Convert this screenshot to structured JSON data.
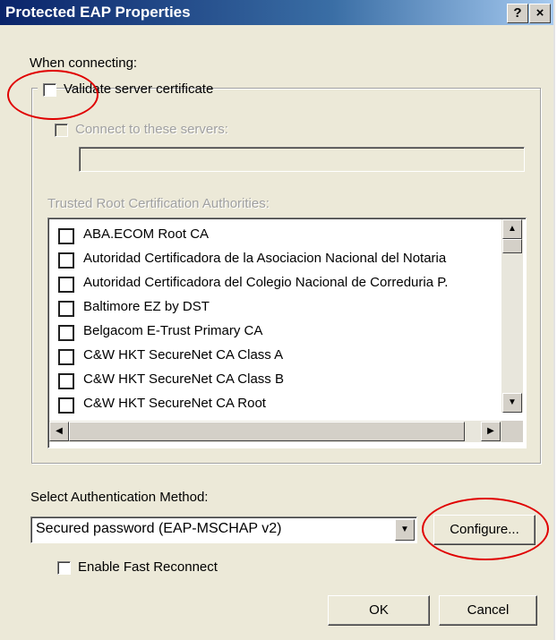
{
  "window": {
    "title": "Protected EAP Properties",
    "help_button": "?",
    "close_button": "×"
  },
  "connecting": {
    "heading": "When connecting:",
    "validate_label": "Validate server certificate",
    "validate_checked": false,
    "connect_label": "Connect to these servers:",
    "connect_checked": false,
    "servers_value": ""
  },
  "trusted": {
    "label": "Trusted Root Certification Authorities:",
    "items": [
      {
        "label": "ABA.ECOM Root CA",
        "checked": false
      },
      {
        "label": "Autoridad Certificadora de la Asociacion Nacional del Notaria",
        "checked": false
      },
      {
        "label": "Autoridad Certificadora del Colegio Nacional de Correduria P.",
        "checked": false
      },
      {
        "label": "Baltimore EZ by DST",
        "checked": false
      },
      {
        "label": "Belgacom E-Trust Primary CA",
        "checked": false
      },
      {
        "label": "C&W HKT SecureNet CA Class A",
        "checked": false
      },
      {
        "label": "C&W HKT SecureNet CA Class B",
        "checked": false
      },
      {
        "label": "C&W HKT SecureNet CA Root",
        "checked": false
      }
    ]
  },
  "auth": {
    "label": "Select Authentication Method:",
    "selected": "Secured password (EAP-MSCHAP v2)",
    "configure_label": "Configure...",
    "fast_reconnect_label": "Enable Fast Reconnect",
    "fast_reconnect_checked": false
  },
  "buttons": {
    "ok": "OK",
    "cancel": "Cancel"
  },
  "colors": {
    "annotation": "#e00000",
    "titlebar": "#0a246a"
  }
}
